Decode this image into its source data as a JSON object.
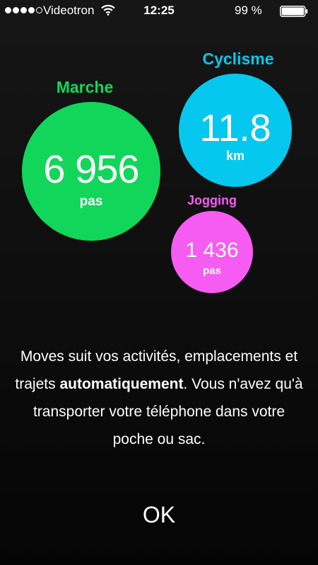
{
  "status_bar": {
    "carrier": "Videotron",
    "time": "12:25",
    "battery": "99 %",
    "signal_bars": 4,
    "signal_max": 5
  },
  "activities": {
    "walk": {
      "label": "Marche",
      "value": "6 956",
      "unit": "pas",
      "color": "#11d65a"
    },
    "cycling": {
      "label": "Cyclisme",
      "value": "11.8",
      "unit": "km",
      "color": "#06c8ee"
    },
    "jogging": {
      "label": "Jogging",
      "value": "1 436",
      "unit": "pas",
      "color": "#f65cf2"
    }
  },
  "message": {
    "part1": "Moves suit vos activités, emplacements et trajets ",
    "emphasis": "automatiquement",
    "part2": ". Vous n'avez qu'à transporter votre téléphone dans votre poche ou sac."
  },
  "ok_label": "OK"
}
